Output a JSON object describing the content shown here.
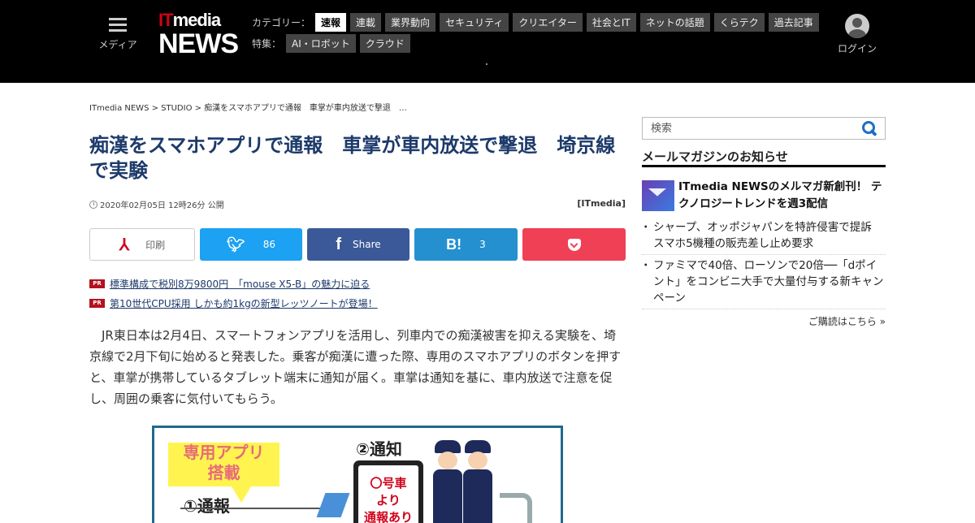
{
  "header": {
    "menu_label": "メディア",
    "logo": {
      "it": "IT",
      "media": "media",
      "news": "NEWS"
    },
    "category_label": "カテゴリー：",
    "categories": [
      "速報",
      "連載",
      "業界動向",
      "セキュリティ",
      "クリエイター",
      "社会とIT",
      "ネットの話題",
      "くらテク",
      "過去記事"
    ],
    "active_category": "速報",
    "special_label": "特集：",
    "specials": [
      "AI・ロボット",
      "クラウド"
    ],
    "login_label": "ログイン"
  },
  "breadcrumb": "ITmedia NEWS > STUDIO > 痴漢をスマホアプリで通報　車掌が車内放送で撃退　…",
  "article": {
    "title": "痴漢をスマホアプリで通報　車掌が車内放送で撃退　埼京線で実験",
    "published": "2020年02月05日 12時26分 公開",
    "source": "[ITmedia]",
    "body": "JR東日本は2月4日、スマートフォンアプリを活用し、列車内での痴漢被害を抑える実験を、埼京線で2月下旬に始めると発表した。乗客が痴漢に遭った際、専用のスマホアプリのボタンを押すと、車掌が携帯しているタブレット端末に通知が届く。車掌は通知を基に、車内放送で注意を促し、周囲の乗客に気付いてもらう。"
  },
  "share": {
    "print_label": "印刷",
    "twitter_count": "86",
    "facebook_label": "Share",
    "hatena_count": "3"
  },
  "pr_links": [
    {
      "badge": "PR",
      "text": "標準構成で税別8万9800円　「mouse X5-B」の魅力に迫る"
    },
    {
      "badge": "PR",
      "text": "第10世代CPU採用 しかも約1kgの新型レッツノートが登場！"
    }
  ],
  "figure": {
    "note": "専用アプリ搭載",
    "note_line1": "専用アプリ",
    "note_line2": "搭載",
    "step1": "①通報",
    "step2": "②通知",
    "screen_line1": "〇号車",
    "screen_line2": "より",
    "screen_line3": "通報あり"
  },
  "sidebar": {
    "search_placeholder": "検索",
    "mailmag_title": "メールマガジンのお知らせ",
    "feature": "ITmedia NEWSのメルマガ新創刊！ テクノロジートレンドを週3配信",
    "items": [
      "シャープ、オッポジャパンを特許侵害で提訴　スマホ5機種の販売差し止め要求",
      "ファミマで40倍、ローソンで20倍──「dポイント」をコンビニ大手で大量付与する新キャンペーン"
    ],
    "subscribe": "ご購読はこちら »"
  },
  "colors": {
    "header_bg": "#000000",
    "headline": "#1d3a6b",
    "twitter": "#1da1f2",
    "facebook": "#3b5998",
    "hatena": "#2490d0",
    "pocket": "#ef4056",
    "pr_badge": "#b3121f"
  }
}
